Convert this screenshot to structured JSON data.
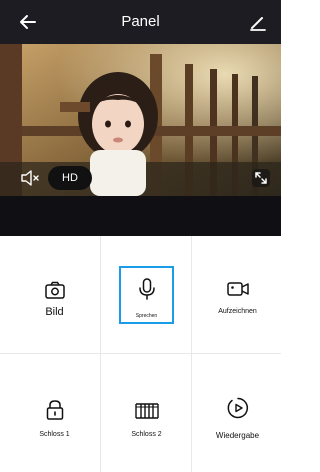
{
  "header": {
    "title": "Panel",
    "back_icon": "arrow-left-icon",
    "edit_icon": "edit-icon"
  },
  "video": {
    "quality_label": "HD",
    "mute_icon": "speaker-mute-icon",
    "fullscreen_icon": "fullscreen-icon"
  },
  "actions": [
    {
      "label": "Bild",
      "icon": "camera-icon"
    },
    {
      "label": "Sprechen",
      "icon": "microphone-icon",
      "selected": true
    },
    {
      "label": "Aufzeichnen",
      "icon": "video-record-icon"
    },
    {
      "label": "Schloss 1",
      "icon": "lock-icon"
    },
    {
      "label": "Schloss 2",
      "icon": "gate-icon"
    },
    {
      "label": "Wiedergabe",
      "icon": "playback-icon"
    }
  ],
  "colors": {
    "header_bg": "#1c1c22",
    "accent": "#1a9ce6"
  }
}
